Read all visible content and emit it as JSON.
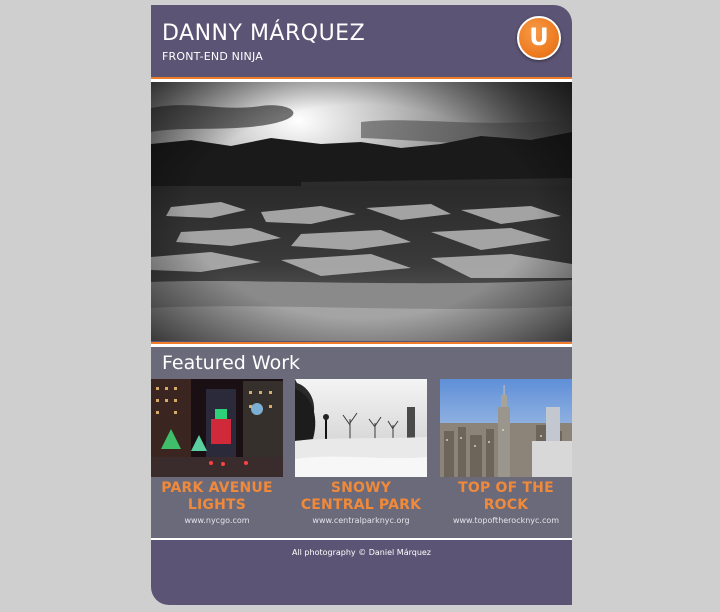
{
  "header": {
    "name": "DANNY MÁRQUEZ",
    "tagline": "FRONT-END NINJA",
    "logo_letter": "U"
  },
  "hero": {
    "image": "winter-river-ice-landscape"
  },
  "featured": {
    "title": "Featured Work",
    "items": [
      {
        "title_line1": "PARK AVENUE",
        "title_line2": "LIGHTS",
        "url": "www.nycgo.com",
        "image": "park-avenue-night-lights"
      },
      {
        "title_line1": "SNOWY",
        "title_line2": "CENTRAL PARK",
        "url": "www.centralparknyc.org",
        "image": "snowy-central-park"
      },
      {
        "title_line1": "TOP OF THE",
        "title_line2": "ROCK",
        "url": "www.topoftherocknyc.com",
        "image": "nyc-skyline-view"
      }
    ]
  },
  "footer": {
    "credit": "All photography © Daniel Márquez"
  },
  "colors": {
    "panel": "#5c5474",
    "accent": "#ef7d2a",
    "featured_bg": "#6b6a7b",
    "page_bg": "#cfcfcf"
  }
}
